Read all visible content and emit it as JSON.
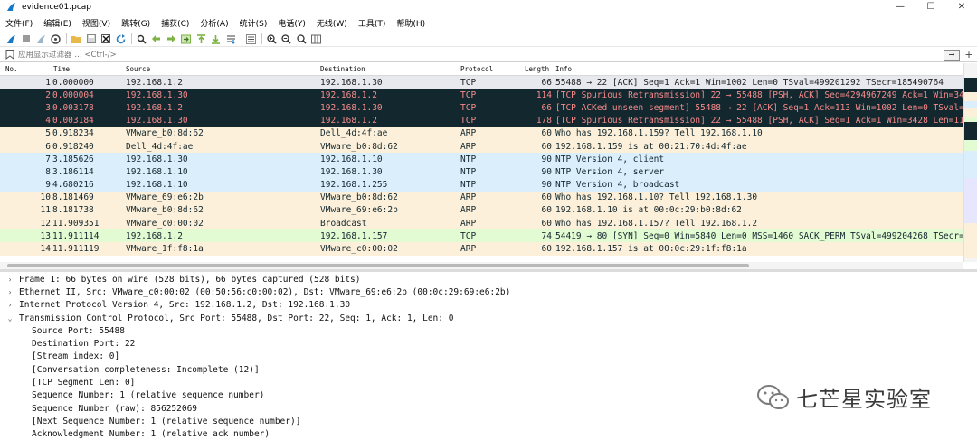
{
  "window": {
    "title": "evidence01.pcap",
    "minimize": "—",
    "maximize": "☐",
    "close": "✕"
  },
  "menu": [
    "文件(F)",
    "编辑(E)",
    "视图(V)",
    "跳转(G)",
    "捕获(C)",
    "分析(A)",
    "统计(S)",
    "电话(Y)",
    "无线(W)",
    "工具(T)",
    "帮助(H)"
  ],
  "filter": {
    "placeholder": "应用显示过滤器 … <Ctrl-/>",
    "apply_label": "→",
    "add_label": "+"
  },
  "packet_list": {
    "columns": [
      "No.",
      "Time",
      "Source",
      "Destination",
      "Protocol",
      "Length",
      "Info"
    ],
    "rows": [
      {
        "no": "1",
        "time": "0.000000",
        "src": "192.168.1.2",
        "dst": "192.168.1.30",
        "proto": "TCP",
        "len": "66",
        "info": "55488 → 22 [ACK] Seq=1 Ack=1 Win=1002 Len=0 TSval=499201292 TSecr=185490764",
        "style": "sel"
      },
      {
        "no": "2",
        "time": "0.000004",
        "src": "192.168.1.30",
        "dst": "192.168.1.2",
        "proto": "TCP",
        "len": "114",
        "info": "[TCP Spurious Retransmission] 22 → 55488 [PSH, ACK] Seq=4294967249 Ack=1 Win=34",
        "style": "bad"
      },
      {
        "no": "3",
        "time": "0.003178",
        "src": "192.168.1.2",
        "dst": "192.168.1.30",
        "proto": "TCP",
        "len": "66",
        "info": "[TCP ACKed unseen segment] 55488 → 22 [ACK] Seq=1 Ack=113 Win=1002 Len=0 TSval=4",
        "style": "bad"
      },
      {
        "no": "4",
        "time": "0.003184",
        "src": "192.168.1.30",
        "dst": "192.168.1.2",
        "proto": "TCP",
        "len": "178",
        "info": "[TCP Spurious Retransmission] 22 → 55488 [PSH, ACK] Seq=1 Ack=1 Win=3428 Len=11",
        "style": "bad"
      },
      {
        "no": "5",
        "time": "0.918234",
        "src": "VMware_b0:8d:62",
        "dst": "Dell_4d:4f:ae",
        "proto": "ARP",
        "len": "60",
        "info": "Who has 192.168.1.159? Tell 192.168.1.10",
        "style": "arp"
      },
      {
        "no": "6",
        "time": "0.918240",
        "src": "Dell_4d:4f:ae",
        "dst": "VMware_b0:8d:62",
        "proto": "ARP",
        "len": "60",
        "info": "192.168.1.159 is at 00:21:70:4d:4f:ae",
        "style": "arp"
      },
      {
        "no": "7",
        "time": "3.185626",
        "src": "192.168.1.30",
        "dst": "192.168.1.10",
        "proto": "NTP",
        "len": "90",
        "info": "NTP Version 4, client",
        "style": "udp"
      },
      {
        "no": "8",
        "time": "3.186114",
        "src": "192.168.1.10",
        "dst": "192.168.1.30",
        "proto": "NTP",
        "len": "90",
        "info": "NTP Version 4, server",
        "style": "udp"
      },
      {
        "no": "9",
        "time": "4.680216",
        "src": "192.168.1.10",
        "dst": "192.168.1.255",
        "proto": "NTP",
        "len": "90",
        "info": "NTP Version 4, broadcast",
        "style": "udp"
      },
      {
        "no": "10",
        "time": "8.181469",
        "src": "VMware_69:e6:2b",
        "dst": "VMware_b0:8d:62",
        "proto": "ARP",
        "len": "60",
        "info": "Who has 192.168.1.10? Tell 192.168.1.30",
        "style": "arp"
      },
      {
        "no": "11",
        "time": "8.181738",
        "src": "VMware_b0:8d:62",
        "dst": "VMware_69:e6:2b",
        "proto": "ARP",
        "len": "60",
        "info": "192.168.1.10 is at 00:0c:29:b0:8d:62",
        "style": "arp"
      },
      {
        "no": "12",
        "time": "11.909351",
        "src": "VMware_c0:00:02",
        "dst": "Broadcast",
        "proto": "ARP",
        "len": "60",
        "info": "Who has 192.168.1.157? Tell 192.168.1.2",
        "style": "arp"
      },
      {
        "no": "13",
        "time": "11.911114",
        "src": "192.168.1.2",
        "dst": "192.168.1.157",
        "proto": "TCP",
        "len": "74",
        "info": "54419 → 80 [SYN] Seq=0 Win=5840 Len=0 MSS=1460 SACK_PERM TSval=499204268 TSecr=",
        "style": "syn"
      },
      {
        "no": "14",
        "time": "11.911119",
        "src": "VMware_1f:f8:1a",
        "dst": "VMware_c0:00:02",
        "proto": "ARP",
        "len": "60",
        "info": "192.168.1.157 is at 00:0c:29:1f:f8:1a",
        "style": "arp"
      }
    ]
  },
  "details": {
    "top": [
      {
        "arrow": "›",
        "text": "Frame 1: 66 bytes on wire (528 bits), 66 bytes captured (528 bits)"
      },
      {
        "arrow": "›",
        "text": "Ethernet II, Src: VMware_c0:00:02 (00:50:56:c0:00:02), Dst: VMware_69:e6:2b (00:0c:29:69:e6:2b)"
      },
      {
        "arrow": "›",
        "text": "Internet Protocol Version 4, Src: 192.168.1.2, Dst: 192.168.1.30"
      },
      {
        "arrow": "⌄",
        "text": "Transmission Control Protocol, Src Port: 55488, Dst Port: 22, Seq: 1, Ack: 1, Len: 0"
      }
    ],
    "tcp_fields": [
      "Source Port: 55488",
      "Destination Port: 22",
      "[Stream index: 0]",
      "[Conversation completeness: Incomplete (12)]",
      "[TCP Segment Len: 0]",
      "Sequence Number: 1    (relative sequence number)",
      "Sequence Number (raw): 856252069",
      "[Next Sequence Number: 1    (relative sequence number)]",
      "Acknowledgment Number: 1    (relative ack number)"
    ]
  },
  "watermark": {
    "text": "七芒星实验室"
  }
}
